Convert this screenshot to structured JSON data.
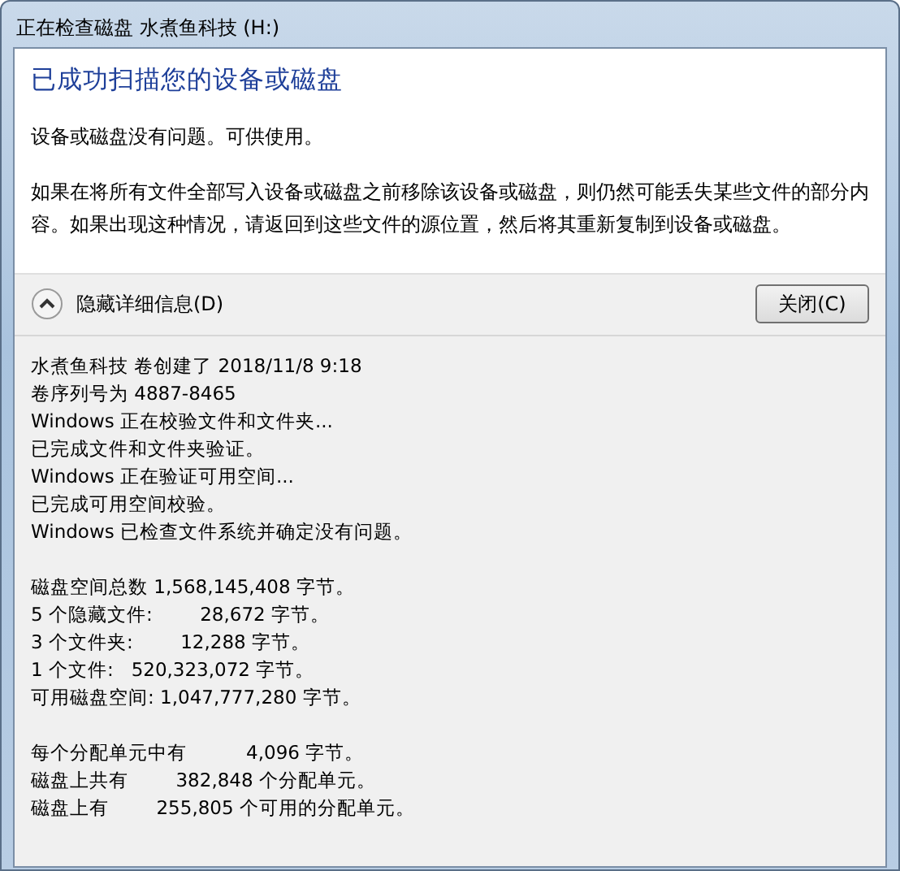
{
  "window": {
    "title": "正在检查磁盘 水煮鱼科技 (H:)"
  },
  "heading": "已成功扫描您的设备或磁盘",
  "messages": [
    "设备或磁盘没有问题。可供使用。",
    "如果在将所有文件全部写入设备或磁盘之前移除该设备或磁盘，则仍然可能丢失某些文件的部分内容。如果出现这种情况，请返回到这些文件的源位置，然后将其重新复制到设备或磁盘。"
  ],
  "details_toggle": {
    "label": "隐藏详细信息(D)",
    "expanded": true
  },
  "buttons": [
    "关闭(C)"
  ],
  "details": [
    [
      "水煮鱼科技 卷创建了 2018/11/8 9:18",
      "卷序列号为 4887-8465",
      "Windows 正在校验文件和文件夹...",
      "已完成文件和文件夹验证。",
      "Windows 正在验证可用空间...",
      "已完成可用空间校验。",
      "Windows 已检查文件系统并确定没有问题。"
    ],
    [
      "磁盘空间总数 1,568,145,408 字节。",
      "5 个隐藏文件:        28,672 字节。",
      "3 个文件夹:        12,288 字节。",
      "1 个文件:   520,323,072 字节。",
      "可用磁盘空间: 1,047,777,280 字节。"
    ],
    [
      "每个分配单元中有          4,096 字节。",
      "磁盘上共有        382,848 个分配单元。",
      "磁盘上有        255,805 个可用的分配单元。"
    ]
  ]
}
